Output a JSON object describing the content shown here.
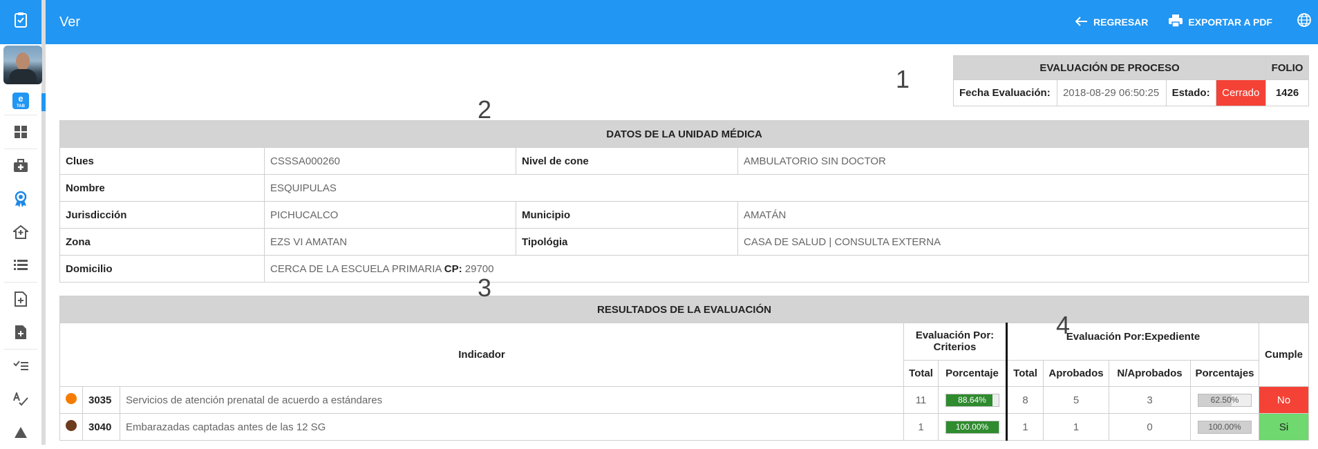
{
  "header": {
    "title": "Ver",
    "back_label": "REGRESAR",
    "export_label": "EXPORTAR A PDF"
  },
  "icons": {
    "logo": "clipboard-icon",
    "back": "arrow-left-icon",
    "export": "printer-icon",
    "language": "globe-icon"
  },
  "sidebar": {
    "app_badge": "e",
    "app_badge_sub": "TAB",
    "items": [
      {
        "name": "dashboard-icon"
      },
      {
        "name": "medical-kit-icon"
      },
      {
        "name": "award-icon"
      },
      {
        "name": "hospital-icon"
      },
      {
        "name": "list-icon"
      },
      {
        "name": "document-add-icon"
      },
      {
        "name": "document-plus-icon"
      },
      {
        "name": "checklist-icon"
      },
      {
        "name": "spellcheck-icon"
      },
      {
        "name": "warning-icon"
      }
    ]
  },
  "markers": [
    "1",
    "2",
    "3",
    "4"
  ],
  "process": {
    "title": "EVALUACIÓN DE PROCESO",
    "folio_label": "FOLIO",
    "date_label": "Fecha Evaluación:",
    "date_value": "2018-08-29 06:50:25",
    "status_label": "Estado:",
    "status_value": "Cerrado",
    "folio_value": "1426"
  },
  "unit": {
    "title": "DATOS DE LA UNIDAD MÉDICA",
    "clues_label": "Clues",
    "clues_value": "CSSSA000260",
    "nivel_label": "Nivel de cone",
    "nivel_value": "AMBULATORIO SIN DOCTOR",
    "nombre_label": "Nombre",
    "nombre_value": "ESQUIPULAS",
    "jurisdiccion_label": "Jurisdicción",
    "jurisdiccion_value": "PICHUCALCO",
    "municipio_label": "Municipio",
    "municipio_value": "AMATÁN",
    "zona_label": "Zona",
    "zona_value": "EZS VI AMATAN",
    "tipologia_label": "Tipológia",
    "tipologia_value": "CASA DE SALUD | CONSULTA EXTERNA",
    "domicilio_label": "Domicilio",
    "domicilio_value": "CERCA DE LA ESCUELA PRIMARIA",
    "cp_label": "CP:",
    "cp_value": "29700"
  },
  "results": {
    "title": "RESULTADOS DE LA EVALUACIÓN",
    "indicador_header": "Indicador",
    "criterios_header": "Evaluación Por: Criterios",
    "expediente_header": "Evaluación Por:Expediente",
    "cumple_header": "Cumple",
    "total_header": "Total",
    "porcentaje_header": "Porcentaje",
    "aprobados_header": "Aprobados",
    "naprobados_header": "N/Aprobados",
    "porcentajes_header": "Porcentajes",
    "rows": [
      {
        "color": "#f57c00",
        "code": "3035",
        "name": "Servicios de atención prenatal de acuerdo a estándares",
        "crit_total": "11",
        "crit_pct_label": "88.64%",
        "crit_pct": 88.64,
        "exp_total": "8",
        "aprobados": "5",
        "naprobados": "3",
        "exp_pct_label": "62.50%",
        "exp_pct": 62.5,
        "cumple": "No"
      },
      {
        "color": "#6d3b1e",
        "code": "3040",
        "name": "Embarazadas captadas antes de las 12 SG",
        "crit_total": "1",
        "crit_pct_label": "100.00%",
        "crit_pct": 100,
        "exp_total": "1",
        "aprobados": "1",
        "naprobados": "0",
        "exp_pct_label": "100.00%",
        "exp_pct": 100,
        "cumple": "Si"
      }
    ]
  }
}
